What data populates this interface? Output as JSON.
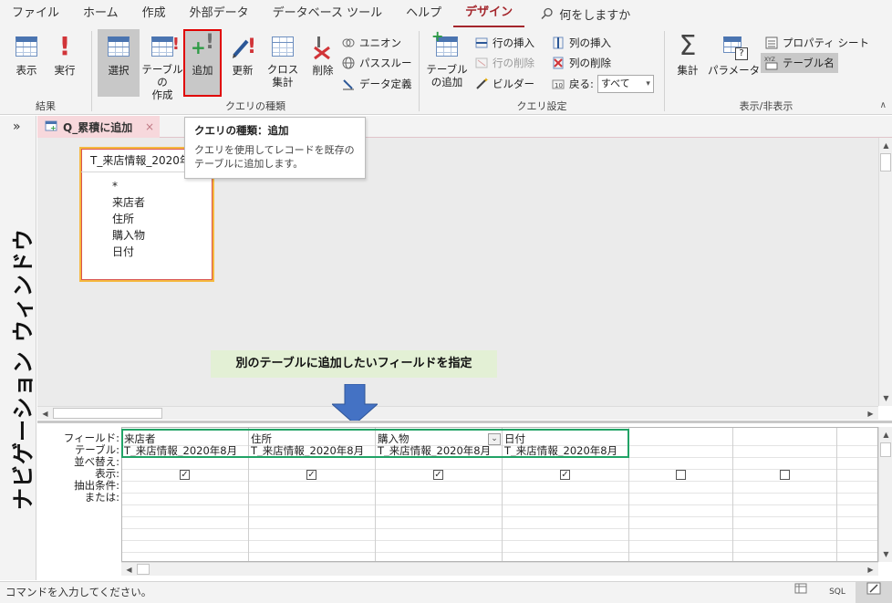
{
  "menu": {
    "tabs": [
      "ファイル",
      "ホーム",
      "作成",
      "外部データ",
      "データベース ツール",
      "ヘルプ",
      "デザイン"
    ],
    "active_tab": "デザイン",
    "tell_me": "何をしますか"
  },
  "ribbon": {
    "results": {
      "label": "結果",
      "view": "表示",
      "run": "実行"
    },
    "query_type": {
      "label": "クエリの種類",
      "select": "選択",
      "make_table": "テーブルの\n作成",
      "append": "追加",
      "update": "更新",
      "crosstab": "クロス\n集計",
      "delete": "削除",
      "union": "ユニオン",
      "passthrough": "パススルー",
      "data_definition": "データ定義"
    },
    "query_setup": {
      "label": "クエリ設定",
      "show_table": "テーブル\nの追加",
      "insert_rows": "行の挿入",
      "delete_rows": "行の削除",
      "builder": "ビルダー",
      "insert_columns": "列の挿入",
      "delete_columns": "列の削除",
      "return_label": "戻る:",
      "return_value": "すべて"
    },
    "show_hide": {
      "label": "表示/非表示",
      "totals": "集計",
      "parameters": "パラメーター",
      "property_sheet": "プロパティ シート",
      "table_names": "テーブル名"
    }
  },
  "nav_pane": {
    "title": "ナビゲーション ウィンドウ",
    "toggle": "»"
  },
  "doc_tab": {
    "title": "Q_累積に追加",
    "close": "×"
  },
  "tooltip": {
    "title": "クエリの種類：追加",
    "body": "クエリを使用してレコードを既存のテーブルに追加します。"
  },
  "table_box": {
    "name": "T_来店情報_2020年8月",
    "fields": [
      "*",
      "来店者",
      "住所",
      "購入物",
      "日付"
    ]
  },
  "callout": "別のテーブルに追加したいフィールドを指定",
  "grid": {
    "row_labels": [
      "フィールド:",
      "テーブル:",
      "並べ替え:",
      "表示:",
      "抽出条件:",
      "または:"
    ],
    "columns": [
      {
        "field": "来店者",
        "table": "T_来店情報_2020年8月",
        "show": true
      },
      {
        "field": "住所",
        "table": "T_来店情報_2020年8月",
        "show": true
      },
      {
        "field": "購入物",
        "table": "T_来店情報_2020年8月",
        "show": true
      },
      {
        "field": "日付",
        "table": "T_来店情報_2020年8月",
        "show": true
      },
      {
        "field": "",
        "table": "",
        "show": false
      },
      {
        "field": "",
        "table": "",
        "show": false
      }
    ]
  },
  "status": {
    "text": "コマンドを入力してください。",
    "view_sql": "SQL"
  },
  "colors": {
    "accent": "#a4262c",
    "highlight_red": "#e00000",
    "highlight_green": "#21a366",
    "callout_bg": "#e3f0d5",
    "arrow": "#4472c4"
  }
}
